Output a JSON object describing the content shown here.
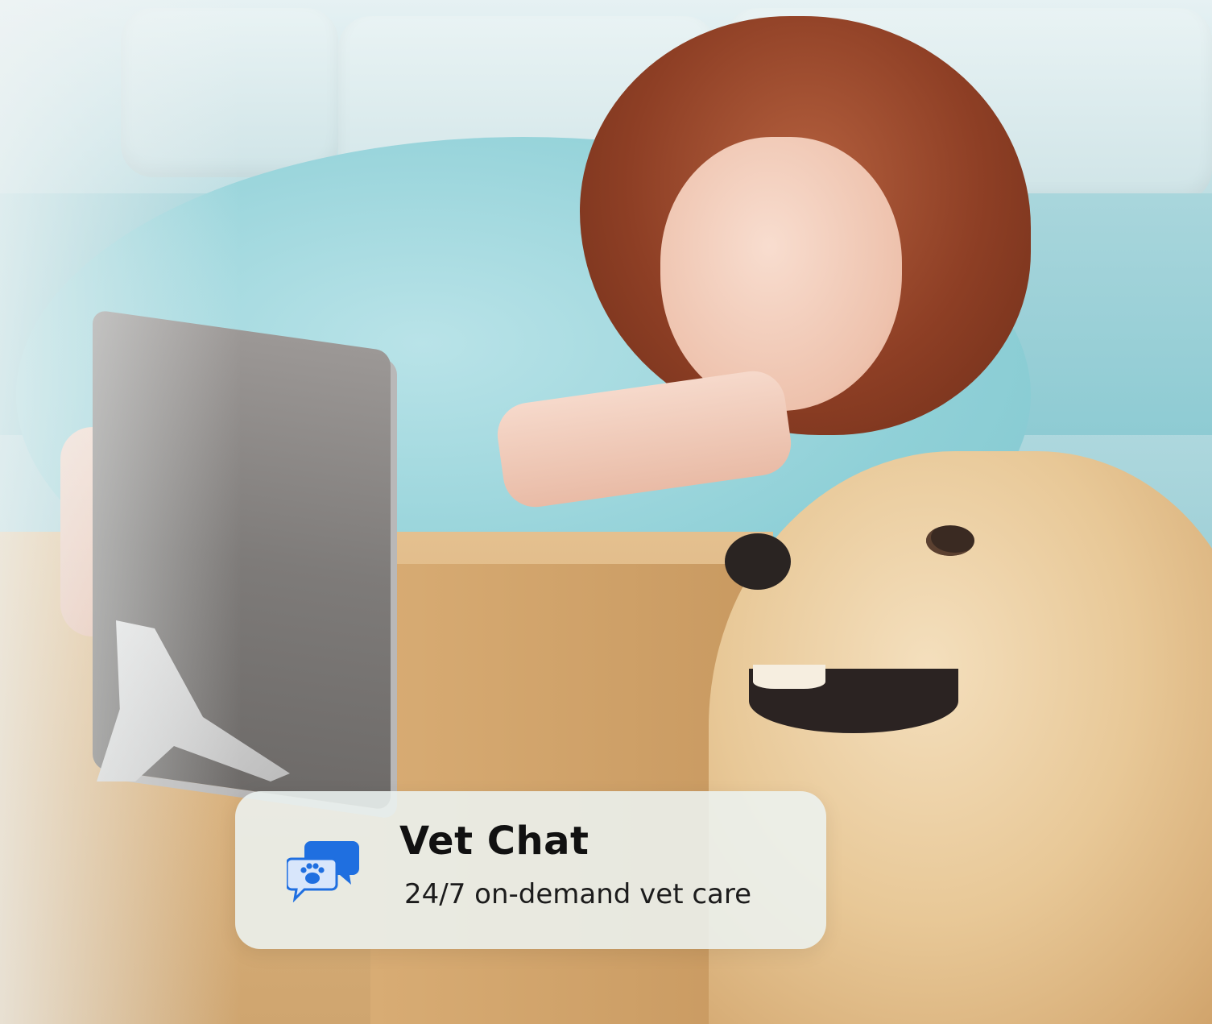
{
  "card": {
    "title": "Vet Chat",
    "subtitle": "24/7 on-demand vet care",
    "icon": "chat-bubbles-paw-icon"
  },
  "colors": {
    "icon_blue": "#1f6fe0",
    "card_bg": "#ecf2f0",
    "title_text": "#111111"
  }
}
